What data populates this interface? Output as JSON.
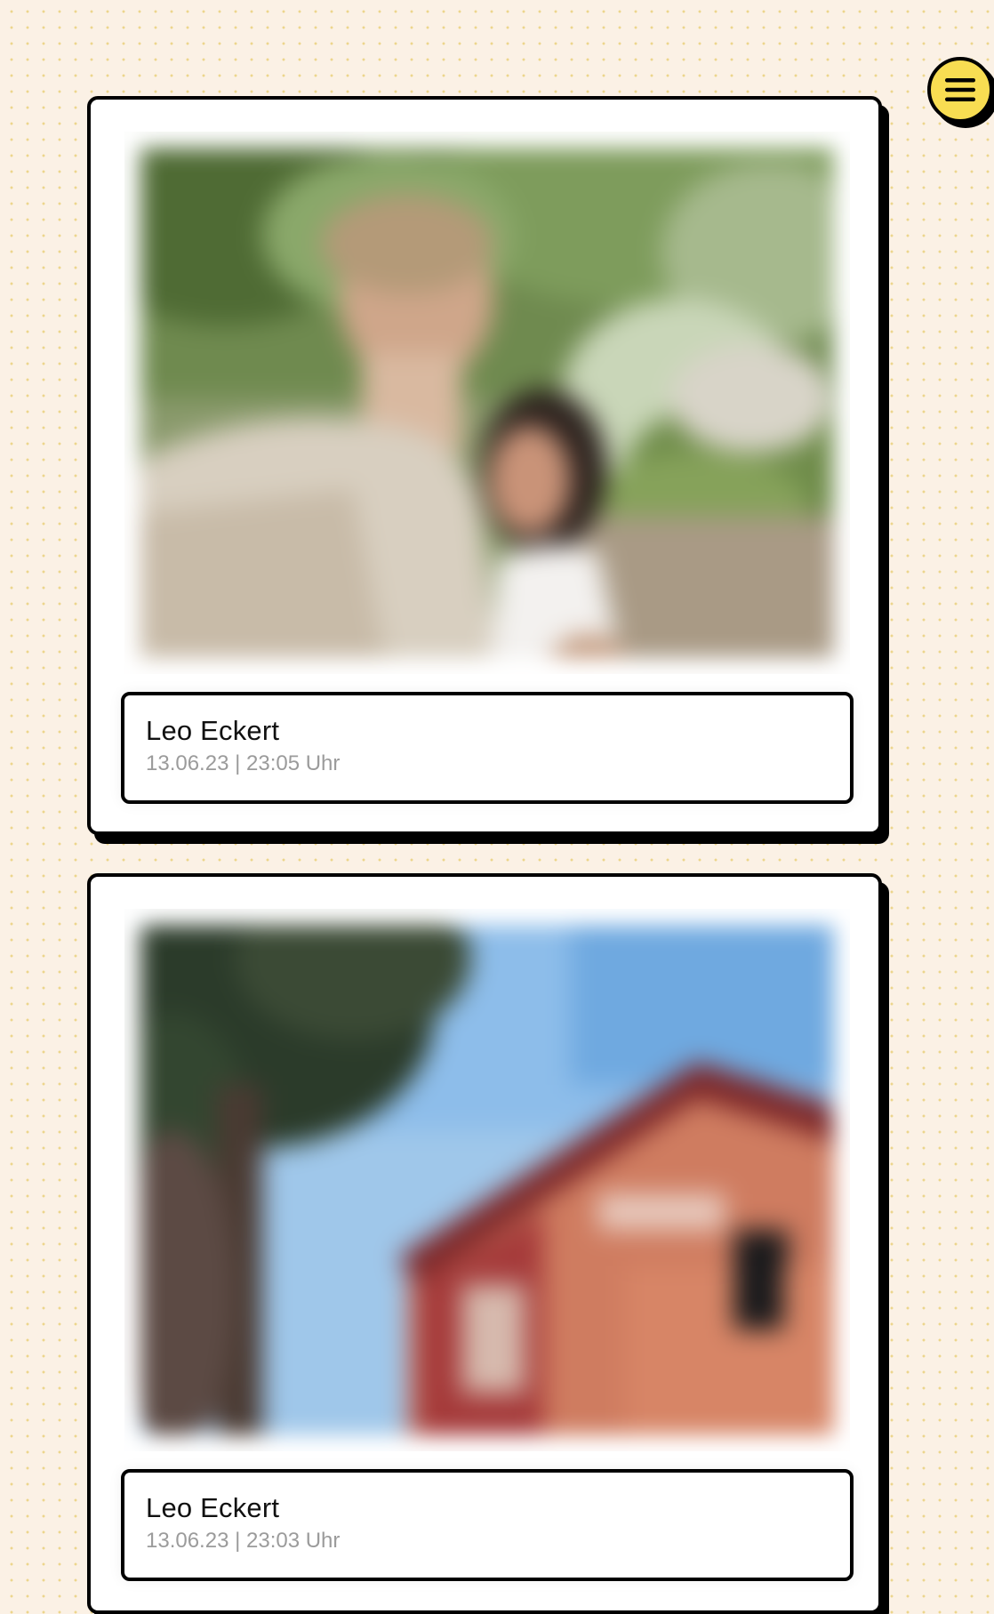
{
  "menu": {
    "icon": "hamburger-menu-icon",
    "accent_color": "#f8dd52"
  },
  "posts": [
    {
      "author": "Leo Eckert",
      "meta": "13.06.23 | 23:05 Uhr",
      "image_subject": "blurred-photo-of-two-people-outdoors"
    },
    {
      "author": "Leo Eckert",
      "meta": "13.06.23 | 23:03 Uhr",
      "image_subject": "blurred-photo-of-red-house-and-tree"
    }
  ],
  "colors": {
    "background": "#fbf1e5",
    "dot": "#ecd58c",
    "border": "#000000",
    "card": "#ffffff",
    "meta_text": "#9b9b9b"
  }
}
